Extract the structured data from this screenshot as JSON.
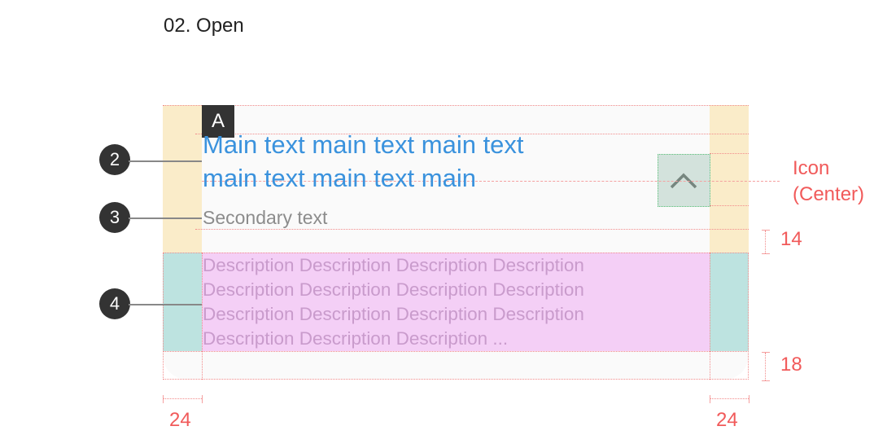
{
  "title": "02. Open",
  "section_label": "A",
  "main_text_lines": [
    "Main text main text main text",
    "main text main text main"
  ],
  "secondary_text": "Secondary text",
  "description_lines": [
    "Description Description Description Description",
    "Description Description Description Description",
    "Description Description Description Description",
    "Description Description Description ..."
  ],
  "callouts": [
    "2",
    "3",
    "4"
  ],
  "icon": "chevron-up-icon",
  "annotations": {
    "icon_label_1": "Icon",
    "icon_label_2": "(Center)",
    "gap_top": "14",
    "gap_bottom": "18",
    "margin_left": "24",
    "margin_right": "24"
  },
  "colors": {
    "main_text": "#3a92dd",
    "margin": "#faecc9",
    "description_bg": "#f4cff6",
    "teal": "#bde3e0",
    "guide": "#f28b8b"
  }
}
